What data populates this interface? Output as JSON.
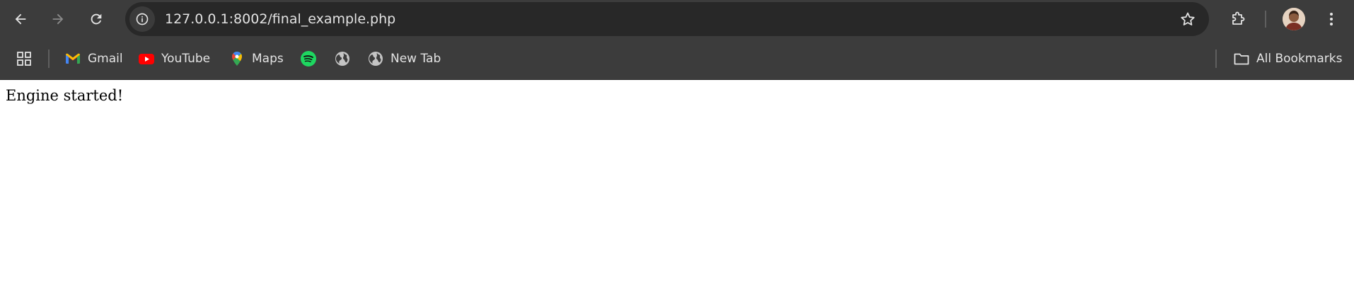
{
  "browser": {
    "address_bar": {
      "url": "127.0.0.1:8002/final_example.php"
    },
    "bookmarks": [
      {
        "label": "Gmail",
        "icon": "gmail-icon"
      },
      {
        "label": "YouTube",
        "icon": "youtube-icon"
      },
      {
        "label": "Maps",
        "icon": "maps-icon"
      },
      {
        "label": "",
        "icon": "spotify-icon"
      },
      {
        "label": "",
        "icon": "globe-icon"
      },
      {
        "label": "New Tab",
        "icon": "globe-icon"
      }
    ],
    "all_bookmarks_label": "All Bookmarks",
    "colors": {
      "chrome_bg": "#3c3c3c",
      "omnibox_bg": "#282828",
      "text": "#e3e3e3",
      "youtube_red": "#ff0000",
      "spotify_green": "#1ed760"
    }
  },
  "page": {
    "message": "Engine started!"
  }
}
